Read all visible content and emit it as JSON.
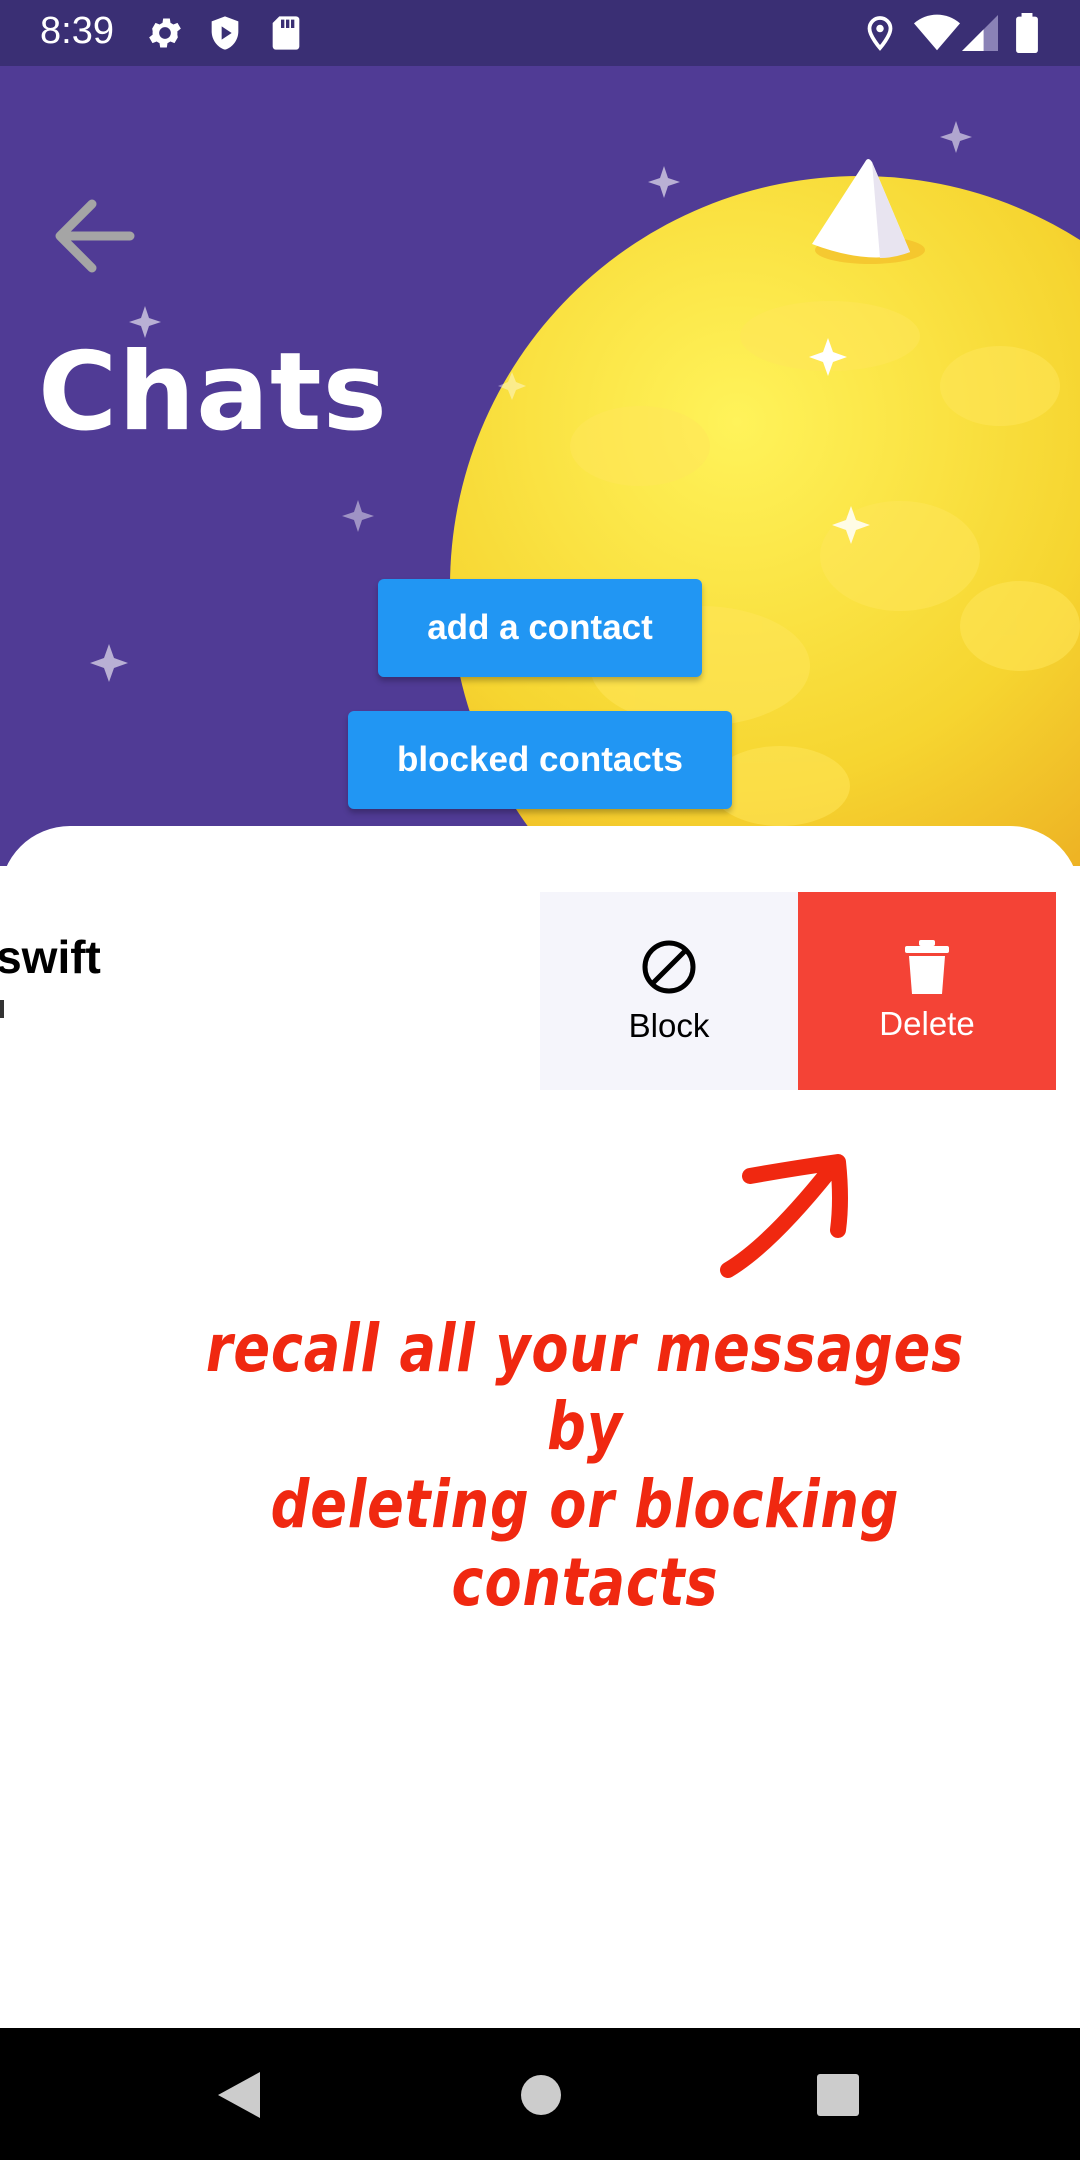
{
  "status_bar": {
    "time": "8:39",
    "left_icons": [
      "gear-icon",
      "shield-icon",
      "sd-card-icon"
    ],
    "right_icons": [
      "location-icon",
      "wifi-icon",
      "signal-icon",
      "battery-icon"
    ]
  },
  "header": {
    "title": "Chats",
    "back_icon": "arrow-left-icon",
    "background_color": "#503b95"
  },
  "buttons": {
    "add_contact": "add a contact",
    "blocked_contacts": "blocked contacts",
    "color": "#2196f3"
  },
  "chat_list": {
    "items": [
      {
        "name": "gswift",
        "actions": {
          "block_label": "Block",
          "block_icon": "block-icon",
          "delete_label": "Delete",
          "delete_icon": "trash-icon",
          "delete_color": "#f44336"
        }
      }
    ]
  },
  "annotation": {
    "line1": "recall all your messages by",
    "line2": "deleting or blocking contacts",
    "color": "#f02810"
  },
  "nav_bar": {
    "icons": [
      "back-triangle-icon",
      "home-circle-icon",
      "recents-square-icon"
    ]
  }
}
